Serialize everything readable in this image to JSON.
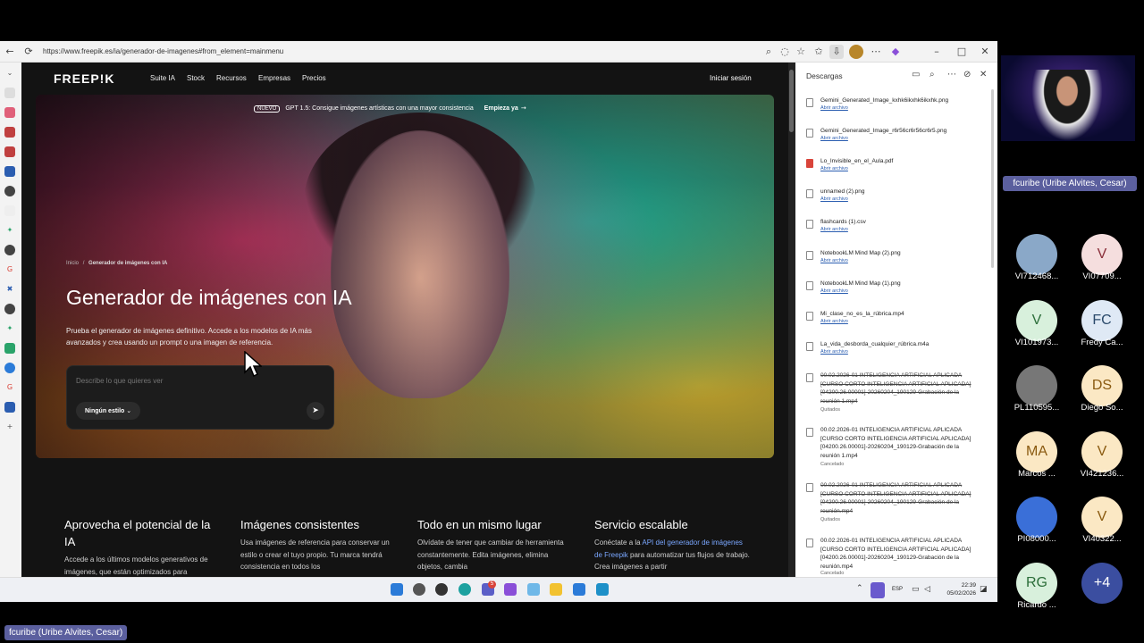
{
  "browser": {
    "url": "https://www.freepik.es/ia/generador-de-imagenes#from_element=mainmenu"
  },
  "site": {
    "logo": "FREEP!K",
    "nav": [
      "Suite IA",
      "Stock",
      "Recursos",
      "Empresas",
      "Precios"
    ],
    "signin": "Iniciar sesión",
    "banner": {
      "badge": "NUEVO",
      "text": "GPT 1.5: Consigue imágenes artísticas con una mayor consistencia",
      "cta": "Empieza ya"
    },
    "breadcrumb": {
      "home": "Inicio",
      "sep": "/",
      "current": "Generador de imágenes con IA"
    },
    "title": "Generador de imágenes con IA",
    "subtitle": "Prueba el generador de imágenes definitivo. Accede a los modelos de IA más avanzados y crea usando un prompt o una imagen de referencia.",
    "prompt": {
      "placeholder": "Describe lo que quieres ver",
      "style": "Ningún estilo"
    },
    "features": [
      {
        "title": "Aprovecha el potencial de la IA",
        "desc": "Accede a los últimos modelos generativos de imágenes, que están optimizados para"
      },
      {
        "title": "Imágenes consistentes",
        "desc": "Usa imágenes de referencia para conservar un estilo o crear el tuyo propio. Tu marca tendrá consistencia en todos los"
      },
      {
        "title": "Todo en un mismo lugar",
        "desc": "Olvídate de tener que cambiar de herramienta constantemente. Edita imágenes, elimina objetos, cambia"
      },
      {
        "title": "Servicio escalable",
        "desc_a": "Conéctate a la ",
        "link": "API del generador de imágenes de Freepik",
        "desc_b": " para automatizar tus flujos de trabajo. Crea imágenes a partir"
      }
    ]
  },
  "downloads": {
    "title": "Descargas",
    "items": [
      {
        "name": "Gemini_Generated_Image_kxhk6ikxhk6ikxhk.png",
        "action": "Abrir archivo"
      },
      {
        "name": "Gemini_Generated_Image_r6r56cr6r56cr6r5.png",
        "action": "Abrir archivo"
      },
      {
        "name": "Lo_Invisible_en_el_Aula.pdf",
        "action": "Abrir archivo"
      },
      {
        "name": "unnamed (2).png",
        "action": "Abrir archivo"
      },
      {
        "name": "flashcards (1).csv",
        "action": "Abrir archivo"
      },
      {
        "name": "NotebookLM Mind Map (2).png",
        "action": "Abrir archivo"
      },
      {
        "name": "NotebookLM Mind Map (1).png",
        "action": "Abrir archivo"
      },
      {
        "name": "Mi_clase_no_es_la_rúbrica.mp4",
        "action": "Abrir archivo"
      },
      {
        "name": "La_vida_desborda_cualquier_rúbrica.m4a",
        "action": "Abrir archivo"
      },
      {
        "name": "00.02.2026-01 INTELIGENCIA ARTIFICIAL APLICADA [CURSO CORTO INTELIGENCIA ARTIFICIAL APLICADA] [04200.26.00001]-20260204_190129-Grabación de la reunión 1.mp4",
        "status": "Quitados"
      },
      {
        "name": "00.02.2026-01 INTELIGENCIA ARTIFICIAL APLICADA [CURSO CORTO INTELIGENCIA ARTIFICIAL APLICADA] [04200.26.00001]-20260204_190129-Grabación de la reunión 1.mp4",
        "status": "Cancelado"
      },
      {
        "name": "00.02.2026-01 INTELIGENCIA ARTIFICIAL APLICADA [CURSO CORTO INTELIGENCIA ARTIFICIAL APLICADA] [04200.26.00001]-20260204_190129-Grabación de la reunión.mp4",
        "status": "Quitados"
      },
      {
        "name": "00.02.2026-01 INTELIGENCIA ARTIFICIAL APLICADA [CURSO CORTO INTELIGENCIA ARTIFICIAL APLICADA] [04200.26.00001]-20260204_190129-Grabación de la reunión.mp4",
        "status": "Cancelado"
      }
    ]
  },
  "taskbar": {
    "lang": "ESP",
    "time": "22:39",
    "date": "05/02/2026",
    "badge": "5"
  },
  "meeting": {
    "self": "fcuribe (Uribe Alvites, Cesar)",
    "participants": [
      {
        "initials": "",
        "name": "VI712468...",
        "bg": "#8aa8c8",
        "photo": true
      },
      {
        "initials": "V",
        "name": "VI07709...",
        "bg": "#f5dede",
        "fg": "#8a2f3a"
      },
      {
        "initials": "V",
        "name": "VI101973...",
        "bg": "#d8f0dc",
        "fg": "#2c6e3a"
      },
      {
        "initials": "FC",
        "name": "Fredy Ca...",
        "bg": "#dfe9f5",
        "fg": "#2b4a6b"
      },
      {
        "initials": "",
        "name": "PL110595...",
        "bg": "#777",
        "photo": true
      },
      {
        "initials": "DS",
        "name": "Diego So...",
        "bg": "#fbe8c4",
        "fg": "#8a5a10"
      },
      {
        "initials": "MA",
        "name": "Marcos ...",
        "bg": "#fbe8c4",
        "fg": "#8a5a10"
      },
      {
        "initials": "V",
        "name": "VI421236...",
        "bg": "#fbe8c4",
        "fg": "#8a5a10"
      },
      {
        "initials": "",
        "name": "PI08000...",
        "bg": "#3a6fd8",
        "photo": true
      },
      {
        "initials": "V",
        "name": "VI40322...",
        "bg": "#fbe8c4",
        "fg": "#8a5a10"
      },
      {
        "initials": "RG",
        "name": "Ricardo ...",
        "bg": "#d8f0dc",
        "fg": "#2c6e3a"
      },
      {
        "initials": "+4",
        "name": "",
        "bg": "#3b4ea0",
        "fg": "#fff"
      }
    ]
  }
}
